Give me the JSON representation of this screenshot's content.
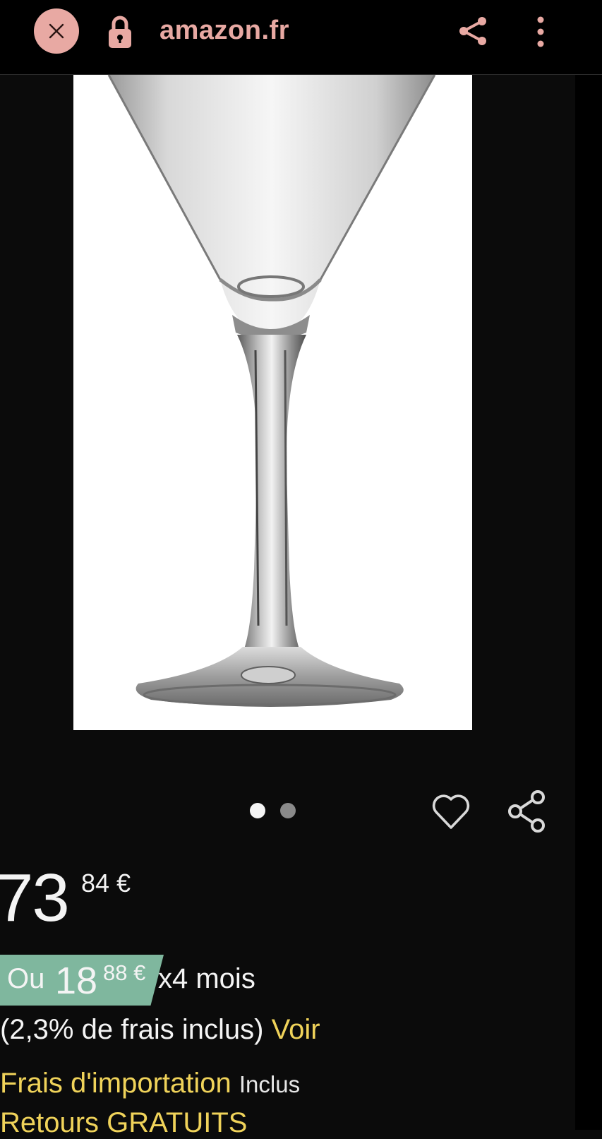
{
  "browser": {
    "url": "amazon.fr",
    "accent_color": "#e8a9a3"
  },
  "gallery": {
    "image_alt": "verre à cocktail en cristal",
    "total_images": 2,
    "active_index": 0
  },
  "price": {
    "whole": "73",
    "fraction": "84 €"
  },
  "installment": {
    "prefix": "Ou",
    "whole": "18",
    "fraction": "88 €",
    "suffix": "x4 mois",
    "badge_color": "#7fb79e"
  },
  "fees": {
    "text": "(2,3% de frais inclus)",
    "link": "Voir"
  },
  "import": {
    "label": "Frais d'importation",
    "value": "Inclus"
  },
  "returns": {
    "text": "Retours GRATUITS"
  },
  "colors": {
    "link_yellow": "#f0d35a",
    "background": "#0b0b0b"
  }
}
